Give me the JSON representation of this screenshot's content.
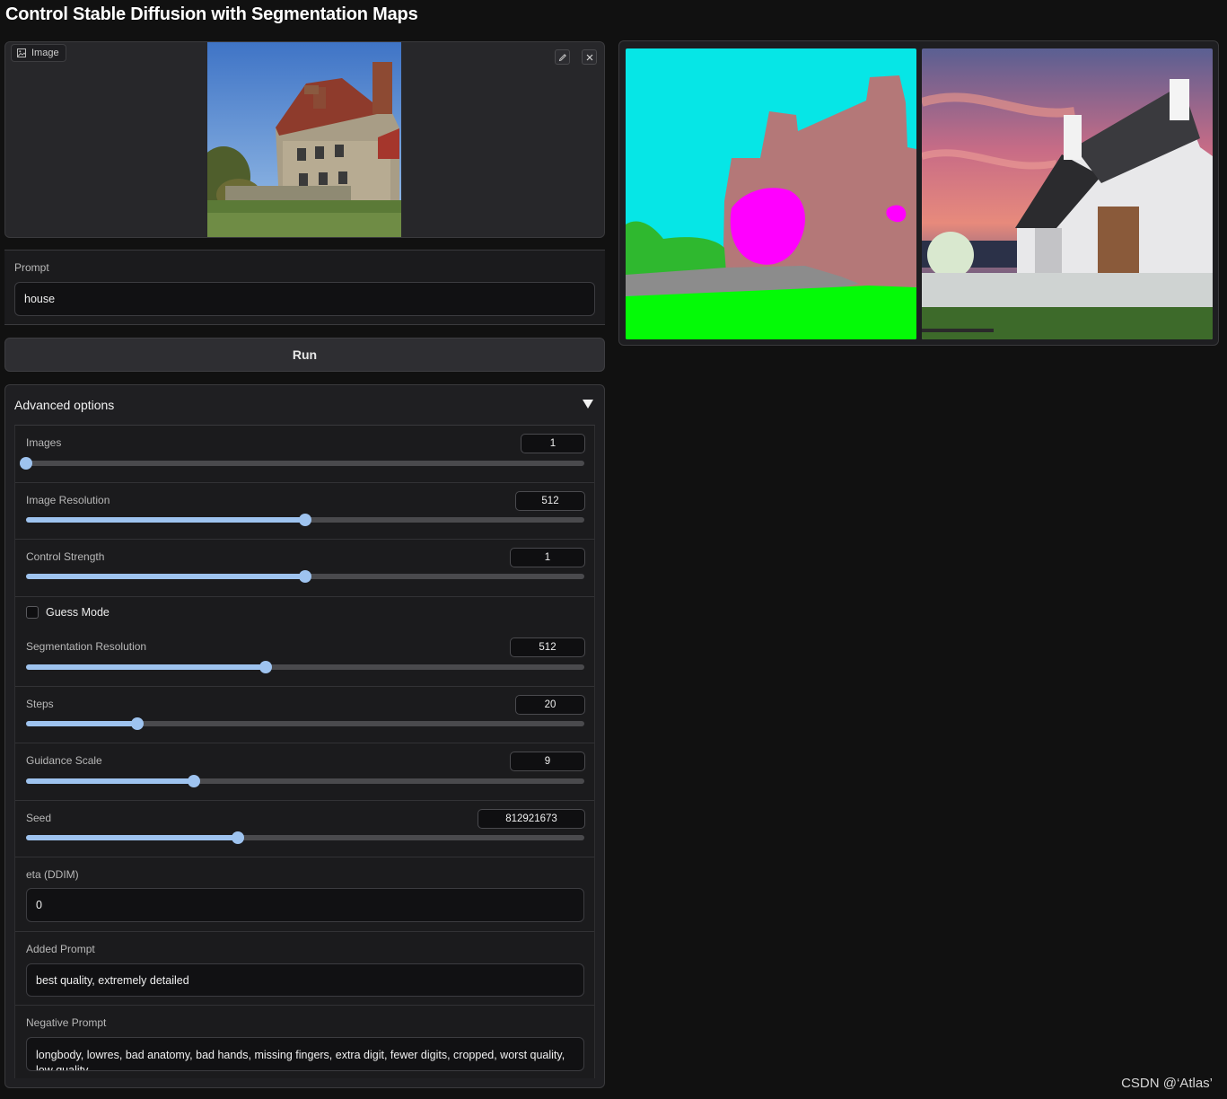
{
  "page": {
    "title": "Control Stable Diffusion with Segmentation Maps"
  },
  "image_input": {
    "label": "Image",
    "label_icon": "image-icon",
    "edit_icon": "pencil-icon",
    "clear_icon": "close-icon"
  },
  "prompt": {
    "label": "Prompt",
    "value": "house"
  },
  "run_button": {
    "label": "Run"
  },
  "advanced": {
    "header": "Advanced options",
    "toggle_icon": "triangle-down-icon",
    "images": {
      "label": "Images",
      "value": "1",
      "fraction": 0.0
    },
    "image_resolution": {
      "label": "Image Resolution",
      "value": "512",
      "fraction": 0.5
    },
    "control_strength": {
      "label": "Control Strength",
      "value": "1",
      "fraction": 0.5
    },
    "guess_mode": {
      "label": "Guess Mode",
      "checked": false
    },
    "segmentation_resolution": {
      "label": "Segmentation Resolution",
      "value": "512",
      "fraction": 0.43
    },
    "steps": {
      "label": "Steps",
      "value": "20",
      "fraction": 0.2
    },
    "guidance_scale": {
      "label": "Guidance Scale",
      "value": "9",
      "fraction": 0.3
    },
    "seed": {
      "label": "Seed",
      "value": "812921673",
      "fraction": 0.38
    },
    "eta": {
      "label": "eta (DDIM)",
      "value": "0"
    },
    "added_prompt": {
      "label": "Added Prompt",
      "value": "best quality, extremely detailed"
    },
    "negative_prompt": {
      "label": "Negative Prompt",
      "value": "longbody, lowres, bad anatomy, bad hands, missing fingers, extra digit, fewer digits, cropped, worst quality, low quality"
    }
  },
  "output": {
    "segmentation_colors": {
      "sky": "#06e6e6",
      "building": "#b47878",
      "tree": "#ff00ff",
      "grass": "#04fa07",
      "road": "#8c8c8c",
      "plant": "#2fb82f"
    }
  },
  "watermark": "CSDN @‘Atlas’"
}
